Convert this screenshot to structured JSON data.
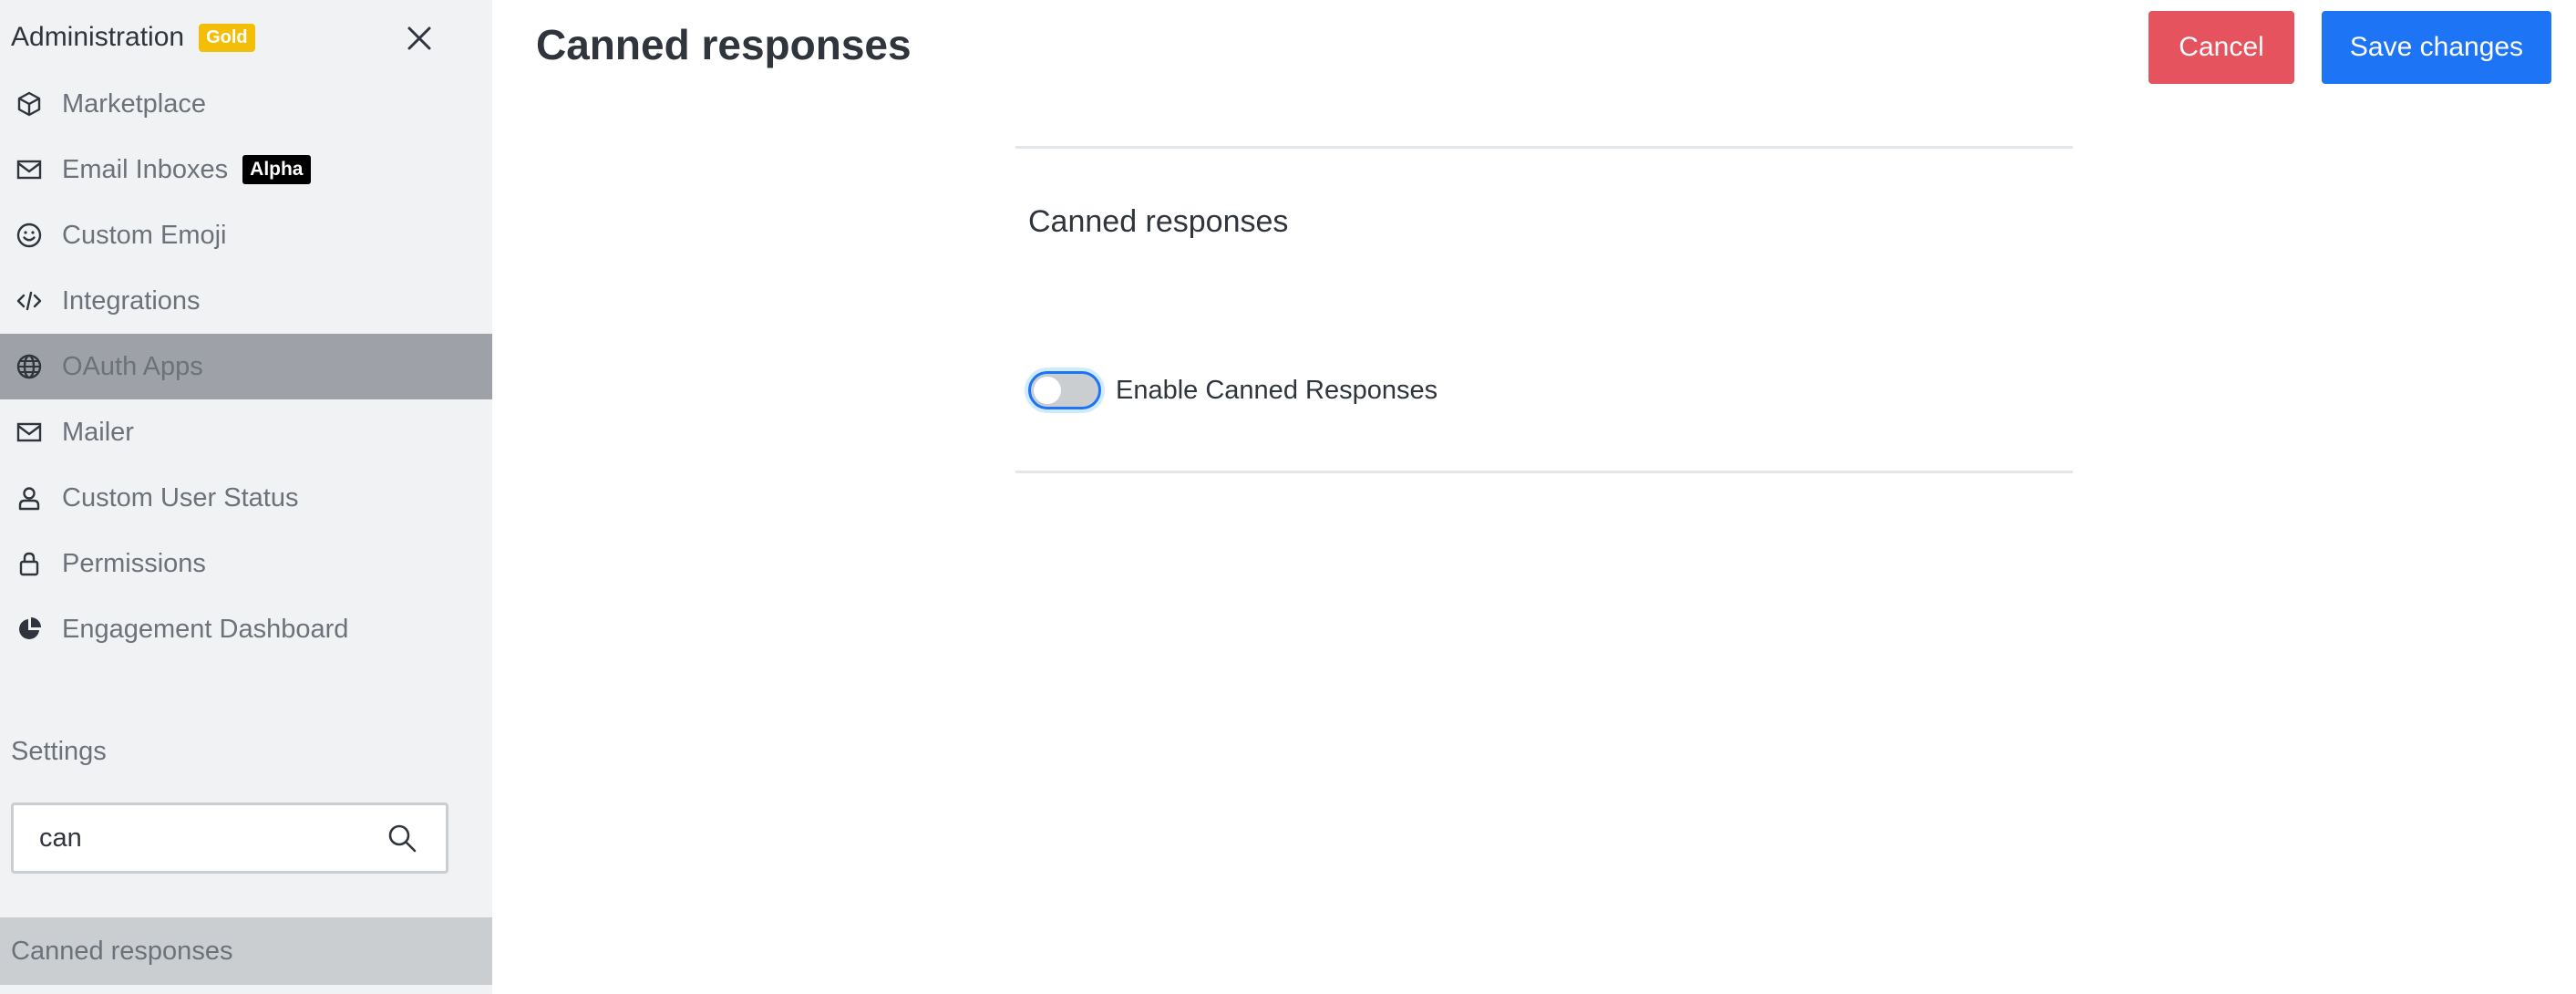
{
  "sidebar": {
    "title": "Administration",
    "plan_badge": "Gold",
    "items": [
      {
        "label": "Marketplace",
        "icon": "cube-icon"
      },
      {
        "label": "Email Inboxes",
        "icon": "mail-icon",
        "badge": "Alpha"
      },
      {
        "label": "Custom Emoji",
        "icon": "emoji-icon"
      },
      {
        "label": "Integrations",
        "icon": "code-icon"
      },
      {
        "label": "OAuth Apps",
        "icon": "globe-icon",
        "active": true
      },
      {
        "label": "Mailer",
        "icon": "mail-icon"
      },
      {
        "label": "Custom User Status",
        "icon": "user-icon"
      },
      {
        "label": "Permissions",
        "icon": "lock-icon"
      },
      {
        "label": "Engagement Dashboard",
        "icon": "pie-chart-icon"
      }
    ],
    "settings_label": "Settings",
    "search": {
      "value": "can",
      "placeholder": ""
    },
    "results": [
      {
        "label": "Canned responses"
      }
    ]
  },
  "main": {
    "title": "Canned responses",
    "cancel_label": "Cancel",
    "save_label": "Save changes",
    "section_title": "Canned responses",
    "toggle_label": "Enable Canned Responses",
    "toggle_on": false
  },
  "colors": {
    "sidebar_bg": "#f1f2f4",
    "active_item_bg": "#9ea2a8",
    "cancel": "#e4535e",
    "primary": "#1d74f5",
    "gold": "#f3be08"
  }
}
